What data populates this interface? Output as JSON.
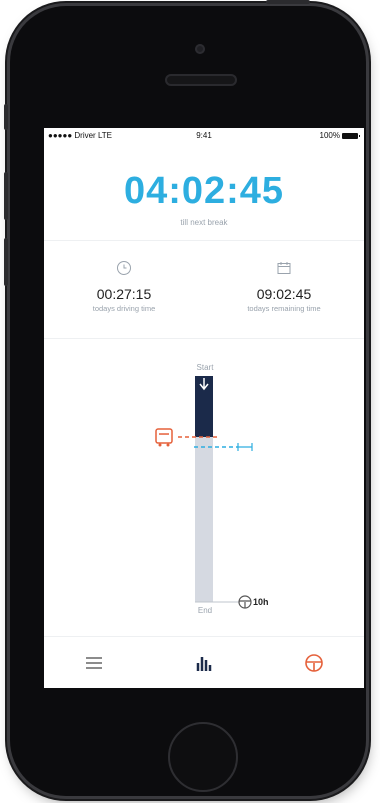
{
  "status_bar": {
    "carrier": "●●●●● Driver  LTE",
    "time": "9:41",
    "battery": "100%"
  },
  "timer": {
    "value": "04:02:45",
    "label": "till next break"
  },
  "stats": [
    {
      "icon": "clock-icon",
      "value": "00:27:15",
      "label": "todays driving time"
    },
    {
      "icon": "calendar-icon",
      "value": "09:02:45",
      "label": "todays remaining time"
    }
  ],
  "progress": {
    "start_label": "Start",
    "end_label": "End",
    "goal_label": "10h",
    "driven_fraction": 0.27,
    "colors": {
      "driven": "#1b2a4a",
      "remaining": "#d5d9e1",
      "truck": "#e5603a",
      "break": "#2daee0"
    }
  },
  "nav": {
    "items": [
      {
        "icon": "menu-icon"
      },
      {
        "icon": "bar-chart-icon"
      },
      {
        "icon": "steering-wheel-icon"
      }
    ]
  }
}
